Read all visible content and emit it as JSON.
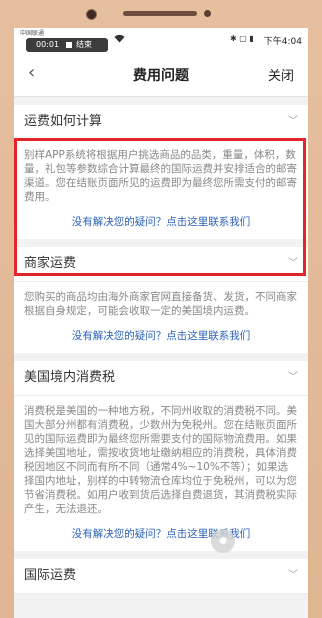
{
  "status_bar": {
    "carrier": "中国联通",
    "recording_time": "00:01",
    "recording_end": "结束",
    "wifi_icon": "wifi-icon",
    "icons": "✱ ▢ ▮",
    "time": "下午4:04"
  },
  "nav": {
    "back_icon": "‹",
    "title": "费用问题",
    "close_label": "关闭"
  },
  "sections": [
    {
      "title": "运费如何计算",
      "chevron": "﹀",
      "text": "别样APP系统将根据用户挑选商品的品类，重量，体积，数量，礼包等参数综合计算最终的国际运费并安排适合的邮寄渠道。您在结账页面所见的运费即为最终您所需支付的邮寄费用。",
      "link": "没有解决您的疑问？点击这里联系我们"
    },
    {
      "title": "商家运费",
      "chevron": "﹀",
      "text": "您购买的商品均由海外商家官网直接备货、发货，不同商家根据自身规定，可能会收取一定的美国境内运费。",
      "link": "没有解决您的疑问？点击这里联系我们"
    },
    {
      "title": "美国境内消费税",
      "chevron": "﹀",
      "text": "消费税是美国的一种地方税，不同州收取的消费税不同。美国大部分州都有消费税，少数州为免税州。您在结账页面所见的国际运费即为最终您所需要支付的国际物流费用。如果选择美国地址，需按收货地址缴纳相应的消费税，具体消费税因地区不同而有所不同（通常4%~10%不等）；如果选择国内地址，别样的中转物流仓库均位于免税州，可以为您节省消费税。如用户收到货后选择自费退货，其消费税实际产生，无法退还。",
      "link": "没有解决您的疑问？点击这里联系我们"
    },
    {
      "title": "国际运费",
      "chevron": "﹀"
    }
  ],
  "colors": {
    "highlight": "#e3252b",
    "link": "#2b62b8"
  }
}
